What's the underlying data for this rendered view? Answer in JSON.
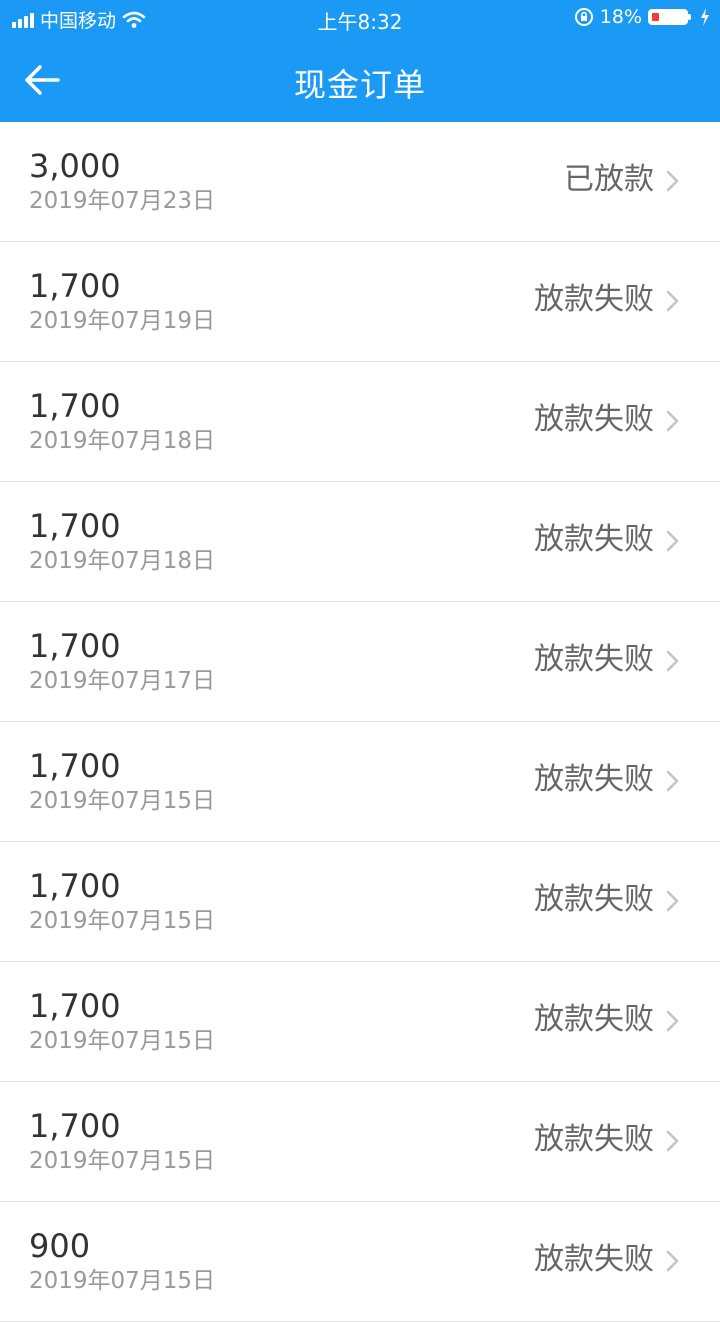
{
  "status_bar": {
    "carrier": "中国移动",
    "time": "上午8:32",
    "battery": "18%",
    "battery_level": 0.18
  },
  "header": {
    "title": "现金订单",
    "back_icon": "back-arrow-icon"
  },
  "orders": [
    {
      "amount": "3,000",
      "date": "2019年07月23日",
      "status": "已放款"
    },
    {
      "amount": "1,700",
      "date": "2019年07月19日",
      "status": "放款失败"
    },
    {
      "amount": "1,700",
      "date": "2019年07月18日",
      "status": "放款失败"
    },
    {
      "amount": "1,700",
      "date": "2019年07月18日",
      "status": "放款失败"
    },
    {
      "amount": "1,700",
      "date": "2019年07月17日",
      "status": "放款失败"
    },
    {
      "amount": "1,700",
      "date": "2019年07月15日",
      "status": "放款失败"
    },
    {
      "amount": "1,700",
      "date": "2019年07月15日",
      "status": "放款失败"
    },
    {
      "amount": "1,700",
      "date": "2019年07月15日",
      "status": "放款失败"
    },
    {
      "amount": "1,700",
      "date": "2019年07月15日",
      "status": "放款失败"
    },
    {
      "amount": "900",
      "date": "2019年07月15日",
      "status": "放款失败"
    }
  ],
  "colors": {
    "accent": "#1a9af5"
  }
}
